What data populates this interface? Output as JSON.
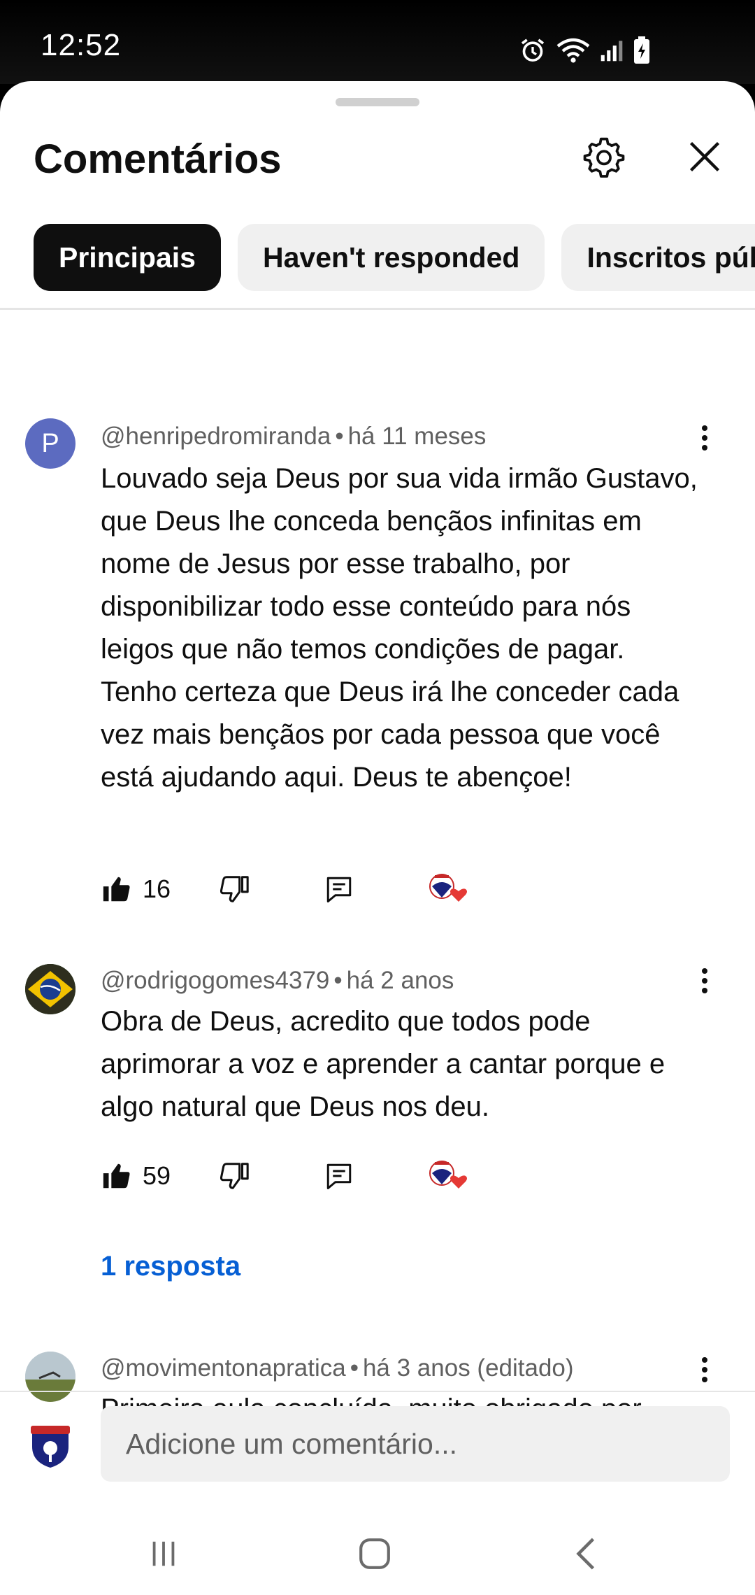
{
  "status_bar": {
    "time": "12:52",
    "icons": [
      "alarm-icon",
      "wifi-icon",
      "signal-icon",
      "battery-charging-icon"
    ]
  },
  "sheet": {
    "title": "Comentários",
    "chips": [
      "Principais",
      "Haven't responded",
      "Inscritos públi"
    ],
    "active_chip": "Principais"
  },
  "comments": [
    {
      "author": "@henripedromiranda",
      "time": "há 11 meses",
      "avatar_letter": "P",
      "text": "Louvado seja Deus por sua vida irmão Gustavo, que Deus lhe conceda bençãos infinitas em nome de Jesus por esse trabalho, por disponibilizar todo esse conteúdo para nós leigos que não temos condições de pagar. Tenho certeza que Deus irá lhe conceder cada vez mais bençãos por cada pessoa que você está ajudando aqui. Deus te abençoe!",
      "likes": "16"
    },
    {
      "author": "@rodrigogomes4379",
      "time": "há 2 anos",
      "text": "Obra de Deus, acredito que todos pode aprimorar a voz e aprender a cantar porque e algo natural que Deus nos deu.",
      "likes": "59",
      "replies": "1 resposta"
    },
    {
      "author": "@movimentonapratica",
      "time": "há 3 anos (editado)",
      "text": "Primeira aula concluída, muito obrigado por todo esse conteúdo gratuito."
    }
  ],
  "composer": {
    "placeholder": "Adicione um comentário..."
  },
  "colors": {
    "link": "#065fd4",
    "heart": "#e53935",
    "chip_active": "#0f0f0f"
  }
}
